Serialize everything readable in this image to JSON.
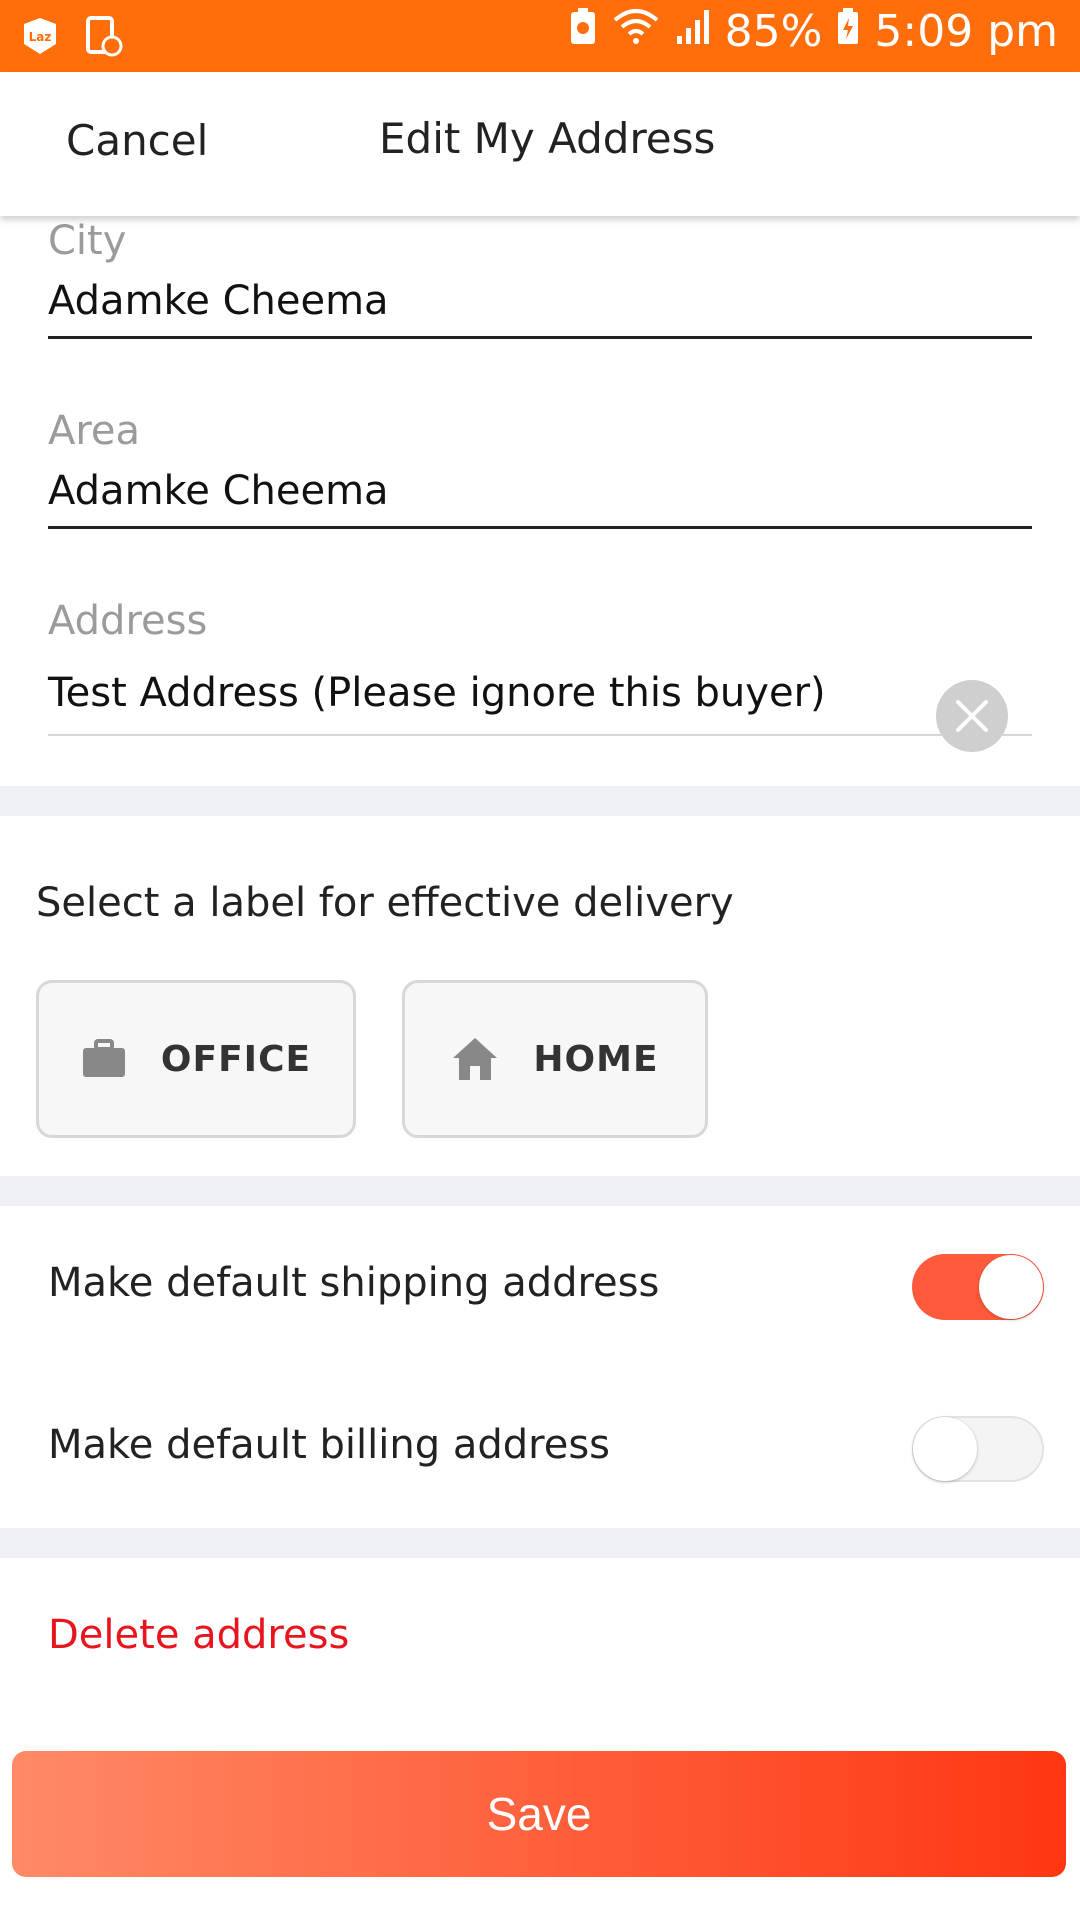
{
  "status_bar": {
    "battery": "85%",
    "time": "5:09 pm",
    "icons": [
      "lazada-app-icon",
      "screen-record-icon",
      "battery-saver-icon",
      "wifi-icon",
      "signal-icon",
      "battery-charging-icon"
    ]
  },
  "header": {
    "cancel_label": "Cancel",
    "title": "Edit My Address"
  },
  "form": {
    "city": {
      "label": "City",
      "value": "Adamke Cheema"
    },
    "area": {
      "label": "Area",
      "value": "Adamke Cheema"
    },
    "address": {
      "label": "Address",
      "value": "Test Address (Please ignore this buyer)"
    }
  },
  "labels_section": {
    "title": "Select a label for effective delivery",
    "options": [
      {
        "label": "OFFICE",
        "icon": "briefcase-icon"
      },
      {
        "label": "HOME",
        "icon": "home-icon"
      }
    ]
  },
  "toggles": [
    {
      "label": "Make default shipping address",
      "on": true
    },
    {
      "label": "Make default billing address",
      "on": false
    }
  ],
  "delete_label": "Delete address",
  "save_label": "Save",
  "colors": {
    "status_bar": "#ff6e0a",
    "accent": "#ff5a3c",
    "delete": "#e8141e",
    "separator": "#eef0f5"
  }
}
